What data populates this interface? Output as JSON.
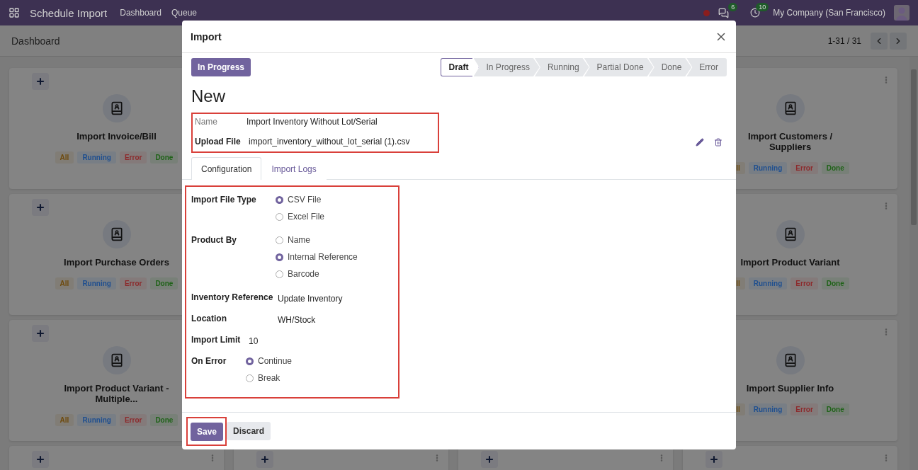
{
  "navbar": {
    "app_name": "Schedule Import",
    "menu": [
      "Dashboard",
      "Queue"
    ],
    "messages_count": "6",
    "activities_count": "10",
    "company": "My Company (San Francisco)"
  },
  "control_panel": {
    "title": "Dashboard",
    "pager": "1-31 / 31"
  },
  "cards": [
    {
      "kind": "card",
      "title": "Import Invoice/Bill",
      "add_button": true,
      "tags": [
        {
          "label": "All",
          "color": "#6e4a0c"
        },
        {
          "label": "Running",
          "color": "#1f4f8f"
        },
        {
          "label": "Error",
          "color": "#8c2a2c"
        },
        {
          "label": "Done",
          "color": "#1f6218"
        }
      ]
    },
    {
      "kind": "hidden"
    },
    {
      "kind": "hidden"
    },
    {
      "kind": "card",
      "title": "Import Customers / Suppliers",
      "menu_button": true,
      "tags": [
        {
          "label": "ll",
          "color": "#6e4a0c"
        },
        {
          "label": "Running",
          "color": "#1f4f8f"
        },
        {
          "label": "Error",
          "color": "#8c2a2c"
        },
        {
          "label": "Done",
          "color": "#1f6218"
        }
      ]
    },
    {
      "kind": "card",
      "title": "Import Purchase Orders",
      "add_button": true,
      "tags": [
        {
          "label": "All",
          "color": "#6e4a0c"
        },
        {
          "label": "Running",
          "color": "#1f4f8f"
        },
        {
          "label": "Error",
          "color": "#8c2a2c"
        },
        {
          "label": "Done",
          "color": "#1f6218"
        }
      ]
    },
    {
      "kind": "hidden"
    },
    {
      "kind": "hidden"
    },
    {
      "kind": "card",
      "title": "Import Product Variant",
      "menu_button": true,
      "tags": [
        {
          "label": "ll",
          "color": "#6e4a0c"
        },
        {
          "label": "Running",
          "color": "#1f4f8f"
        },
        {
          "label": "Error",
          "color": "#8c2a2c"
        },
        {
          "label": "Done",
          "color": "#1f6218"
        }
      ]
    },
    {
      "kind": "card",
      "title": "Import Product Variant - Multiple...",
      "add_button": true,
      "tags": [
        {
          "label": "All",
          "color": "#6e4a0c"
        },
        {
          "label": "Running",
          "color": "#1f4f8f"
        },
        {
          "label": "Error",
          "color": "#8c2a2c"
        },
        {
          "label": "Done",
          "color": "#1f6218"
        }
      ]
    },
    {
      "kind": "hidden"
    },
    {
      "kind": "hidden"
    },
    {
      "kind": "card",
      "title": "Import Supplier Info",
      "menu_button": true,
      "tags": [
        {
          "label": "ll",
          "color": "#6e4a0c"
        },
        {
          "label": "Running",
          "color": "#1f4f8f"
        },
        {
          "label": "Error",
          "color": "#8c2a2c"
        },
        {
          "label": "Done",
          "color": "#1f6218"
        }
      ]
    },
    {
      "kind": "card",
      "add_button": true,
      "menu_button": true
    },
    {
      "kind": "card",
      "add_button": true,
      "menu_button": true
    },
    {
      "kind": "card",
      "add_button": true,
      "menu_button": true
    },
    {
      "kind": "card",
      "add_button": true,
      "menu_button": true
    }
  ],
  "dialog": {
    "title": "Import",
    "action_button": "In Progress",
    "stages": [
      {
        "label": "Draft",
        "selected": true
      },
      {
        "label": "In Progress",
        "selected": false
      },
      {
        "label": "Running",
        "selected": false
      },
      {
        "label": "Partial Done",
        "selected": false
      },
      {
        "label": "Done",
        "selected": false
      },
      {
        "label": "Error",
        "selected": false
      }
    ],
    "record_title": "New",
    "fields": [
      {
        "label": "Name",
        "value": "Import Inventory Without Lot/Serial",
        "kind": "muted"
      },
      {
        "label": "Upload File",
        "value": "import_inventory_without_lot_serial (1).csv",
        "kind": "bold"
      }
    ],
    "tabs": [
      {
        "label": "Configuration",
        "selected": true
      },
      {
        "label": "Import Logs",
        "selected": false
      }
    ],
    "config": [
      {
        "label": "Import File Type",
        "kind": "radio",
        "options": [
          {
            "label": "CSV File",
            "selected": true
          },
          {
            "label": "Excel File",
            "selected": false
          }
        ]
      },
      {
        "label": "Product By",
        "kind": "radio",
        "options": [
          {
            "label": "Name",
            "selected": false
          },
          {
            "label": "Internal Reference",
            "selected": true
          },
          {
            "label": "Barcode",
            "selected": false
          }
        ]
      },
      {
        "label": "Inventory Reference",
        "kind": "text",
        "value": "Update Inventory"
      },
      {
        "label": "Location",
        "kind": "text",
        "value": "WH/Stock"
      },
      {
        "label": "Import Limit",
        "kind": "text",
        "value": "10"
      },
      {
        "label": "On Error",
        "kind": "radio",
        "options": [
          {
            "label": "Continue",
            "selected": true
          },
          {
            "label": "Break",
            "selected": false
          }
        ]
      }
    ],
    "buttons": [
      {
        "label": "Save",
        "kind": "primary"
      },
      {
        "label": "Discard",
        "kind": "secondary"
      }
    ]
  }
}
